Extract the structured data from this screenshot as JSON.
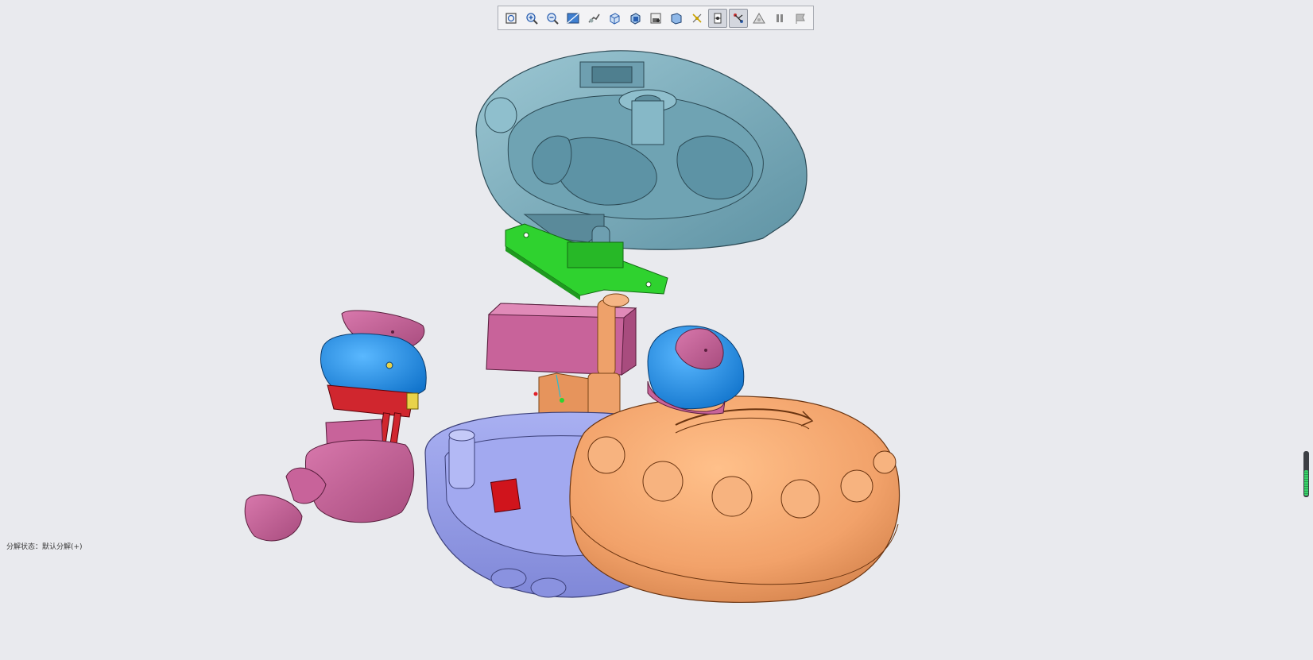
{
  "status": {
    "explode_state_text": "分解状态：默认分解(+)"
  },
  "toolbar": {
    "buttons": [
      {
        "icon": "zoom-fit-icon",
        "active": false
      },
      {
        "icon": "zoom-in-icon",
        "active": false
      },
      {
        "icon": "zoom-out-icon",
        "active": false
      },
      {
        "icon": "view-normal-icon",
        "active": false
      },
      {
        "icon": "display-style-icon",
        "active": false
      },
      {
        "icon": "saved-views-icon",
        "active": false
      },
      {
        "icon": "section-view-icon",
        "active": false
      },
      {
        "icon": "view-manager-icon",
        "active": false
      },
      {
        "icon": "perspective-icon",
        "active": false
      },
      {
        "icon": "datum-display-icon",
        "active": false
      },
      {
        "icon": "spin-center-icon",
        "active": true
      },
      {
        "icon": "annotation-display-icon",
        "active": true
      },
      {
        "icon": "appearance-icon",
        "active": false
      },
      {
        "icon": "pause-icon",
        "active": false
      },
      {
        "icon": "flag-icon",
        "active": false
      }
    ]
  },
  "scroll_level": 0.6,
  "colors": {
    "background": "#e9eaee",
    "top_shell": "#7fb1c1",
    "pcb": "#2fd22f",
    "magenta_part": "#c8639a",
    "blue_part": "#1e90e8",
    "red_part": "#d0262e",
    "orange_part": "#eea16a",
    "base_shell": "#98a0ea"
  }
}
